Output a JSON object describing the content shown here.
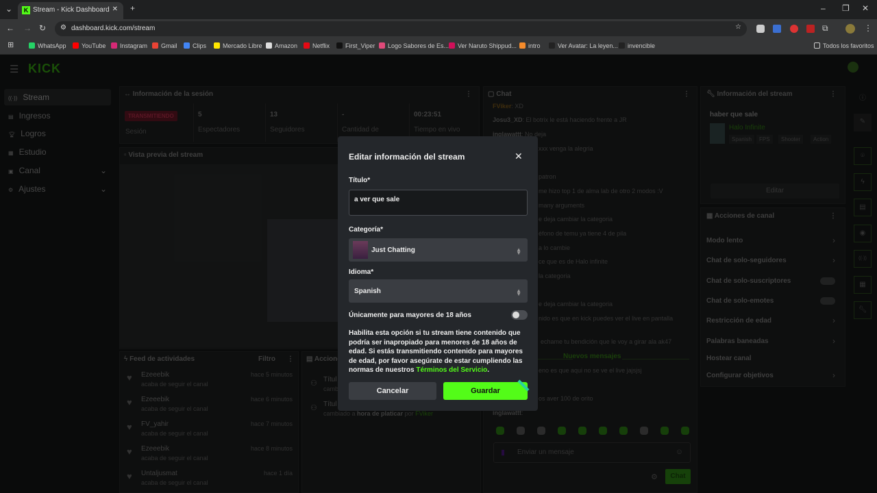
{
  "browser": {
    "tab_title": "Stream - Kick Dashboard",
    "url": "dashboard.kick.com/stream",
    "bookmarks": [
      {
        "label": "WhatsApp",
        "color": "#25d366"
      },
      {
        "label": "YouTube",
        "color": "#ff0000"
      },
      {
        "label": "Instagram",
        "color": "#d62976"
      },
      {
        "label": "Gmail",
        "color": "#ea4335"
      },
      {
        "label": "Clips",
        "color": "#4285f4"
      },
      {
        "label": "Mercado Libre",
        "color": "#ffe600"
      },
      {
        "label": "Amazon",
        "color": "#dddddd"
      },
      {
        "label": "Netflix",
        "color": "#e50914"
      },
      {
        "label": "First_Viper",
        "color": "#111111"
      },
      {
        "label": "Logo Sabores de Es...",
        "color": "#e04a7a"
      },
      {
        "label": "Ver Naruto Shippud...",
        "color": "#d0105a"
      },
      {
        "label": "intro",
        "color": "#f58b2b"
      },
      {
        "label": "Ver Avatar: La leyen...",
        "color": "#222222"
      },
      {
        "label": "invencible",
        "color": "#222222"
      }
    ],
    "all_bookmarks": "Todos los favoritos"
  },
  "brand": {
    "logo": "KICK",
    "accent": "#53fc18"
  },
  "sidebar": [
    {
      "label": "Stream",
      "icon": "broadcast-icon"
    },
    {
      "label": "Ingresos"
    },
    {
      "label": "Logros"
    },
    {
      "label": "Estudio"
    },
    {
      "label": "Canal"
    },
    {
      "label": "Ajustes"
    }
  ],
  "session": {
    "title": "Información de la sesión",
    "status": "TRANSMITIENDO",
    "status_label": "Sesión",
    "stats": [
      {
        "value": "5",
        "label": "Espectadores"
      },
      {
        "value": "13",
        "label": "Seguidores"
      },
      {
        "value": "-",
        "label": "Cantidad de"
      },
      {
        "value": "00:23:51",
        "label": "Tiempo en vivo"
      }
    ]
  },
  "preview": {
    "title": "Vista previa del stream"
  },
  "feed": {
    "title": "Feed de actividades",
    "filter": "Filtro",
    "items": [
      {
        "user": "Ezeeebik",
        "action": "acaba de seguir el canal",
        "time": "hace 5 minutos"
      },
      {
        "user": "Ezeeebik",
        "action": "acaba de seguir el canal",
        "time": "hace 6 minutos"
      },
      {
        "user": "FV_yahir",
        "action": "acaba de seguir el canal",
        "time": "hace 7 minutos"
      },
      {
        "user": "Ezeeebik",
        "action": "acaba de seguir el canal",
        "time": "hace 8 minutos"
      },
      {
        "user": "Untaljusmat",
        "action": "acaba de seguir el canal",
        "time": "hace 1 día"
      }
    ]
  },
  "mod_actions": {
    "title": "Accione",
    "items": [
      {
        "title": "Títul",
        "sub": "camb"
      },
      {
        "title": "Títul",
        "sub_prefix": "cambiado a",
        "sub_bold": "hora de platicar",
        "sub_by": "por",
        "sub_user": "FViker"
      }
    ]
  },
  "chat": {
    "title": "Chat",
    "messages": [
      {
        "user": "FViker",
        "text": ": XD"
      },
      {
        "user": "Josu3_XD",
        "text": ": El botrix le está haciendo frente a JR"
      },
      {
        "user": "inglawattt",
        "text": ": No deja"
      },
      {
        "text": "xxx venga la alegria"
      },
      {
        "text": "patron"
      },
      {
        "text": "me hizo top 1 de alma lab de otro 2 modos :V"
      },
      {
        "text": "many arguments"
      },
      {
        "text": "e deja cambiar la categoria"
      },
      {
        "text": "éfono de temu ya tiene 4 de pila"
      },
      {
        "text": "a lo cambie"
      },
      {
        "text": "ce que es de Halo infinite"
      },
      {
        "text": "la categoria"
      },
      {
        "text": "e deja cambiar la categoria"
      },
      {
        "text": "nido es que en kick puedes ver el live en pantalla"
      },
      {
        "text": "echame tu bendición que le voy a girar ala ak47"
      },
      {
        "text": "eno es que aqui no se ve el live jajsjsj"
      },
      {
        "text": "os aver 100 de orito"
      },
      {
        "user": "inglawattt",
        "text": ":"
      }
    ],
    "new_messages": "Nuevos mensajes",
    "input_placeholder": "Enviar un mensaje",
    "send": "Chat"
  },
  "stream_info": {
    "title": "Información del stream",
    "stream_title": "haber que sale",
    "category": "Halo Infinite",
    "tags": [
      "Spanish",
      "FPS",
      "Shooter",
      "Action"
    ],
    "edit": "Editar"
  },
  "channel_actions": {
    "title": "Acciones de canal",
    "items": [
      {
        "label": "Modo lento",
        "type": "arrow"
      },
      {
        "label": "Chat de solo-seguidores",
        "type": "arrow"
      },
      {
        "label": "Chat de solo-suscriptores",
        "type": "toggle"
      },
      {
        "label": "Chat de solo-emotes",
        "type": "toggle"
      },
      {
        "label": "Restricción de edad",
        "type": "arrow"
      },
      {
        "label": "Palabras baneadas",
        "type": "arrow"
      },
      {
        "label": "Hostear canal",
        "type": "none"
      },
      {
        "label": "Configurar objetivos",
        "type": "arrow"
      }
    ]
  },
  "modal": {
    "title": "Editar información del stream",
    "title_label": "Título*",
    "title_value": "a ver que sale",
    "category_label": "Categoría*",
    "category_value": "Just Chatting",
    "language_label": "Idioma*",
    "language_value": "Spanish",
    "adult_label": "Únicamente para mayores de 18 años",
    "adult_on": false,
    "desc": "Habilita esta opción si tu stream tiene contenido que podría ser inapropiado para menores de 18 años de edad. Si estás transmitiendo contenido para mayores de edad, por favor asegúrate de estar cumpliendo las normas de nuestros ",
    "terms": "Términos del Servicio",
    "period": ".",
    "cancel": "Cancelar",
    "save": "Guardar"
  }
}
